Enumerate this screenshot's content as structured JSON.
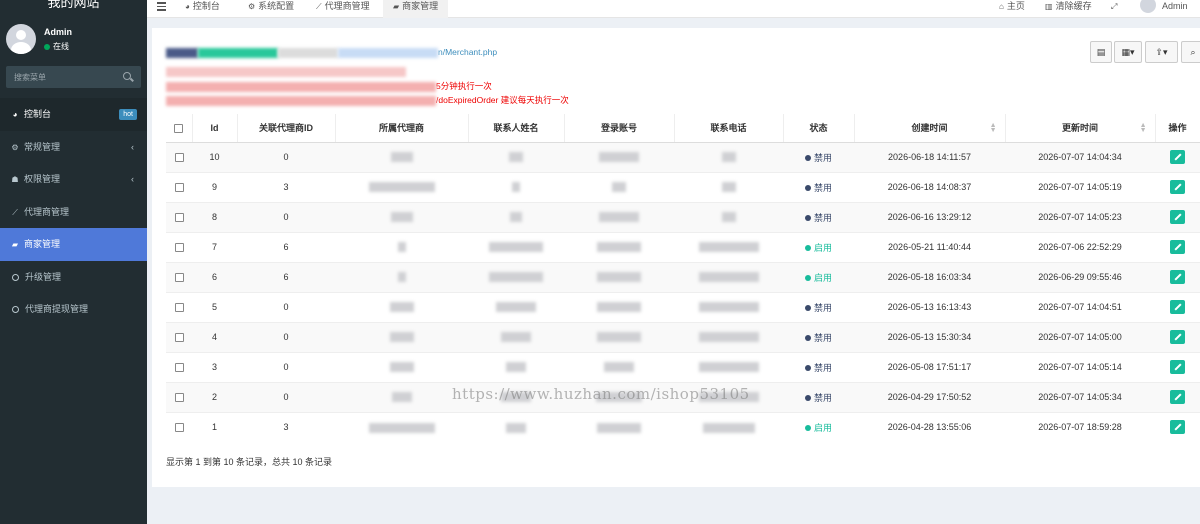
{
  "brand": {
    "title": "我的网站"
  },
  "user": {
    "name": "Admin",
    "status": "在线"
  },
  "sidebar": {
    "search_placeholder": "搜索菜单",
    "items": [
      {
        "label": "控制台",
        "icon": "dashboard-icon",
        "badge": "hot"
      },
      {
        "label": "常规管理",
        "icon": "cogs-icon"
      },
      {
        "label": "权限管理",
        "icon": "group-icon"
      },
      {
        "label": "代理商管理",
        "icon": "line-chart-icon"
      },
      {
        "label": "商家管理",
        "icon": "briefcase-icon"
      },
      {
        "label": "升级管理",
        "icon": "circle-icon"
      },
      {
        "label": "代理商提现管理",
        "icon": "circle-icon"
      }
    ]
  },
  "topbar": {
    "tabs": [
      {
        "label": "控制台",
        "icon": "dashboard-icon"
      },
      {
        "label": "系统配置",
        "icon": "gear-icon"
      },
      {
        "label": "代理商管理",
        "icon": "line-chart-icon"
      },
      {
        "label": "商家管理",
        "icon": "briefcase-icon"
      }
    ],
    "home": "主页",
    "clear_cache": "清除缓存",
    "admin": "Admin"
  },
  "info": {
    "url_suffix": "n/Merchant.php",
    "line2_suffix": "5分钟执行一次",
    "line3_suffix": "/doExpiredOrder 建议每天执行一次"
  },
  "table": {
    "headers": [
      "Id",
      "关联代理商ID",
      "所属代理商",
      "联系人姓名",
      "登录账号",
      "联系电话",
      "状态",
      "创建时间",
      "更新时间",
      "操作"
    ],
    "rows": [
      {
        "id": "10",
        "agent_id": "0",
        "status": "禁用",
        "status_color": "#3a4a6b",
        "created": "2026-06-18 14:11:57",
        "updated": "2026-07-07 14:04:34"
      },
      {
        "id": "9",
        "agent_id": "3",
        "status": "禁用",
        "status_color": "#3a4a6b",
        "created": "2026-06-18 14:08:37",
        "updated": "2026-07-07 14:05:19"
      },
      {
        "id": "8",
        "agent_id": "0",
        "status": "禁用",
        "status_color": "#3a4a6b",
        "created": "2026-06-16 13:29:12",
        "updated": "2026-07-07 14:05:23"
      },
      {
        "id": "7",
        "agent_id": "6",
        "status": "启用",
        "status_color": "#18bc9c",
        "created": "2026-05-21 11:40:44",
        "updated": "2026-07-06 22:52:29"
      },
      {
        "id": "6",
        "agent_id": "6",
        "status": "启用",
        "status_color": "#18bc9c",
        "created": "2026-05-18 16:03:34",
        "updated": "2026-06-29 09:55:46"
      },
      {
        "id": "5",
        "agent_id": "0",
        "status": "禁用",
        "status_color": "#3a4a6b",
        "created": "2026-05-13 16:13:43",
        "updated": "2026-07-07 14:04:51"
      },
      {
        "id": "4",
        "agent_id": "0",
        "status": "禁用",
        "status_color": "#3a4a6b",
        "created": "2026-05-13 15:30:34",
        "updated": "2026-07-07 14:05:00"
      },
      {
        "id": "3",
        "agent_id": "0",
        "status": "禁用",
        "status_color": "#3a4a6b",
        "created": "2026-05-08 17:51:17",
        "updated": "2026-07-07 14:05:14"
      },
      {
        "id": "2",
        "agent_id": "0",
        "status": "禁用",
        "status_color": "#3a4a6b",
        "created": "2026-04-29 17:50:52",
        "updated": "2026-07-07 14:05:34"
      },
      {
        "id": "1",
        "agent_id": "3",
        "status": "启用",
        "status_color": "#18bc9c",
        "created": "2026-04-28 13:55:06",
        "updated": "2026-07-07 18:59:28"
      }
    ]
  },
  "footer": {
    "summary": "显示第 1 到第 10 条记录，总共 10 条记录"
  },
  "watermark": "https://www.huzhan.com/ishop53105",
  "colors": {
    "sidebar_bg": "#222d32",
    "active_menu": "#4f79d9",
    "enabled": "#18bc9c",
    "disabled": "#3a4a6b",
    "link": "#3c8dbc",
    "warning_text": "#ee0000"
  }
}
